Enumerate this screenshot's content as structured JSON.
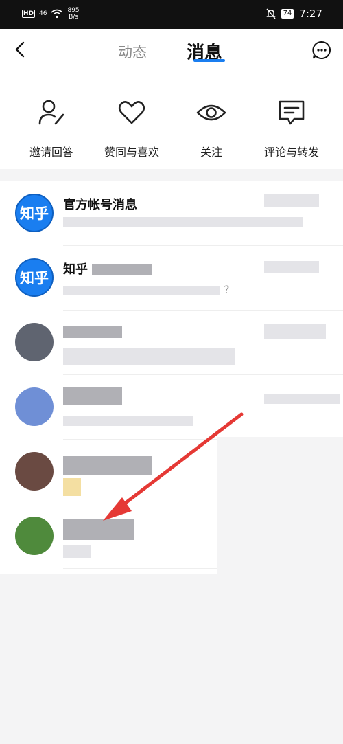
{
  "status_bar": {
    "hd_label": "HD",
    "signal_label": "46",
    "net_speed_value": "895",
    "net_speed_unit": "B/s",
    "battery": "74",
    "time": "7:27"
  },
  "header": {
    "tab_dynamic": "动态",
    "tab_messages": "消息",
    "active_tab": "消息"
  },
  "categories": [
    {
      "label": "邀请回答",
      "icon": "person-pen-icon"
    },
    {
      "label": "赞同与喜欢",
      "icon": "heart-icon"
    },
    {
      "label": "关注",
      "icon": "eye-icon"
    },
    {
      "label": "评论与转发",
      "icon": "comment-icon"
    }
  ],
  "messages": [
    {
      "title": "官方帐号消息",
      "avatar_text": "知乎"
    },
    {
      "title": "知乎",
      "avatar_text": "知乎",
      "preview_suffix": "?"
    },
    {
      "title": "",
      "avatar_text": ""
    },
    {
      "title": "",
      "avatar_text": ""
    },
    {
      "title": "",
      "avatar_text": ""
    },
    {
      "title": "",
      "avatar_text": ""
    }
  ],
  "colors": {
    "accent": "#1a7ef0",
    "arrow": "#e53935",
    "status_bar_bg": "#111111"
  }
}
